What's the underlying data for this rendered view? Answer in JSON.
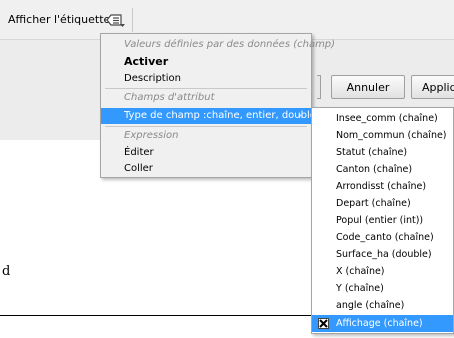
{
  "toolbar": {
    "label": "Afficher l'étiquette",
    "button_icon": "label-dropdown-icon"
  },
  "dialog": {
    "cancel_label": "Annuler",
    "apply_label": "Appliquer",
    "partial_text": "d"
  },
  "menu": {
    "items": [
      {
        "label": "Valeurs définies par des données (champ)",
        "kind": "section"
      },
      {
        "label": "Activer",
        "kind": "bold"
      },
      {
        "label": "Description",
        "kind": "item"
      },
      {
        "label": "Champs d'attribut",
        "kind": "section"
      },
      {
        "label": "Type de champ :chaîne, entier, double",
        "kind": "submenu",
        "highlighted": true,
        "arrow": "›"
      },
      {
        "label": "Expression",
        "kind": "section"
      },
      {
        "label": "Éditer",
        "kind": "item"
      },
      {
        "label": "Coller",
        "kind": "item"
      }
    ]
  },
  "submenu": {
    "items": [
      {
        "label": "Insee_comm   (chaîne)"
      },
      {
        "label": "Nom_commun   (chaîne)"
      },
      {
        "label": "Statut   (chaîne)"
      },
      {
        "label": "Canton   (chaîne)"
      },
      {
        "label": "Arrondisst   (chaîne)"
      },
      {
        "label": "Depart   (chaîne)"
      },
      {
        "label": "Popul   (entier (int))"
      },
      {
        "label": "Code_canto   (chaîne)"
      },
      {
        "label": "Surface_ha   (double)"
      },
      {
        "label": "X   (chaîne)"
      },
      {
        "label": "Y   (chaîne)"
      },
      {
        "label": "angle   (chaîne)"
      },
      {
        "label": "Affichage   (chaîne)",
        "highlighted": true,
        "checked": true
      }
    ]
  },
  "colors": {
    "highlight": "#3399ff",
    "menu_bg": "#f0f0f0",
    "section_text": "#8a8a8a"
  }
}
